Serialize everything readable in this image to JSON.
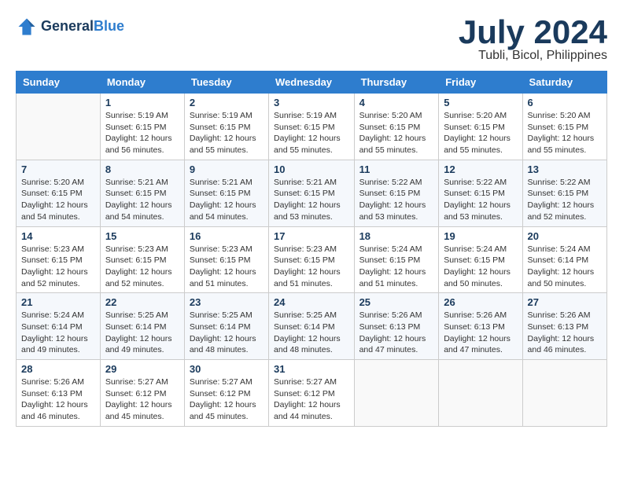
{
  "header": {
    "logo_line1": "General",
    "logo_line2": "Blue",
    "month": "July 2024",
    "location": "Tubli, Bicol, Philippines"
  },
  "weekdays": [
    "Sunday",
    "Monday",
    "Tuesday",
    "Wednesday",
    "Thursday",
    "Friday",
    "Saturday"
  ],
  "weeks": [
    [
      {
        "day": "",
        "info": ""
      },
      {
        "day": "1",
        "info": "Sunrise: 5:19 AM\nSunset: 6:15 PM\nDaylight: 12 hours\nand 56 minutes."
      },
      {
        "day": "2",
        "info": "Sunrise: 5:19 AM\nSunset: 6:15 PM\nDaylight: 12 hours\nand 55 minutes."
      },
      {
        "day": "3",
        "info": "Sunrise: 5:19 AM\nSunset: 6:15 PM\nDaylight: 12 hours\nand 55 minutes."
      },
      {
        "day": "4",
        "info": "Sunrise: 5:20 AM\nSunset: 6:15 PM\nDaylight: 12 hours\nand 55 minutes."
      },
      {
        "day": "5",
        "info": "Sunrise: 5:20 AM\nSunset: 6:15 PM\nDaylight: 12 hours\nand 55 minutes."
      },
      {
        "day": "6",
        "info": "Sunrise: 5:20 AM\nSunset: 6:15 PM\nDaylight: 12 hours\nand 55 minutes."
      }
    ],
    [
      {
        "day": "7",
        "info": "Sunrise: 5:20 AM\nSunset: 6:15 PM\nDaylight: 12 hours\nand 54 minutes."
      },
      {
        "day": "8",
        "info": "Sunrise: 5:21 AM\nSunset: 6:15 PM\nDaylight: 12 hours\nand 54 minutes."
      },
      {
        "day": "9",
        "info": "Sunrise: 5:21 AM\nSunset: 6:15 PM\nDaylight: 12 hours\nand 54 minutes."
      },
      {
        "day": "10",
        "info": "Sunrise: 5:21 AM\nSunset: 6:15 PM\nDaylight: 12 hours\nand 53 minutes."
      },
      {
        "day": "11",
        "info": "Sunrise: 5:22 AM\nSunset: 6:15 PM\nDaylight: 12 hours\nand 53 minutes."
      },
      {
        "day": "12",
        "info": "Sunrise: 5:22 AM\nSunset: 6:15 PM\nDaylight: 12 hours\nand 53 minutes."
      },
      {
        "day": "13",
        "info": "Sunrise: 5:22 AM\nSunset: 6:15 PM\nDaylight: 12 hours\nand 52 minutes."
      }
    ],
    [
      {
        "day": "14",
        "info": "Sunrise: 5:23 AM\nSunset: 6:15 PM\nDaylight: 12 hours\nand 52 minutes."
      },
      {
        "day": "15",
        "info": "Sunrise: 5:23 AM\nSunset: 6:15 PM\nDaylight: 12 hours\nand 52 minutes."
      },
      {
        "day": "16",
        "info": "Sunrise: 5:23 AM\nSunset: 6:15 PM\nDaylight: 12 hours\nand 51 minutes."
      },
      {
        "day": "17",
        "info": "Sunrise: 5:23 AM\nSunset: 6:15 PM\nDaylight: 12 hours\nand 51 minutes."
      },
      {
        "day": "18",
        "info": "Sunrise: 5:24 AM\nSunset: 6:15 PM\nDaylight: 12 hours\nand 51 minutes."
      },
      {
        "day": "19",
        "info": "Sunrise: 5:24 AM\nSunset: 6:15 PM\nDaylight: 12 hours\nand 50 minutes."
      },
      {
        "day": "20",
        "info": "Sunrise: 5:24 AM\nSunset: 6:14 PM\nDaylight: 12 hours\nand 50 minutes."
      }
    ],
    [
      {
        "day": "21",
        "info": "Sunrise: 5:24 AM\nSunset: 6:14 PM\nDaylight: 12 hours\nand 49 minutes."
      },
      {
        "day": "22",
        "info": "Sunrise: 5:25 AM\nSunset: 6:14 PM\nDaylight: 12 hours\nand 49 minutes."
      },
      {
        "day": "23",
        "info": "Sunrise: 5:25 AM\nSunset: 6:14 PM\nDaylight: 12 hours\nand 48 minutes."
      },
      {
        "day": "24",
        "info": "Sunrise: 5:25 AM\nSunset: 6:14 PM\nDaylight: 12 hours\nand 48 minutes."
      },
      {
        "day": "25",
        "info": "Sunrise: 5:26 AM\nSunset: 6:13 PM\nDaylight: 12 hours\nand 47 minutes."
      },
      {
        "day": "26",
        "info": "Sunrise: 5:26 AM\nSunset: 6:13 PM\nDaylight: 12 hours\nand 47 minutes."
      },
      {
        "day": "27",
        "info": "Sunrise: 5:26 AM\nSunset: 6:13 PM\nDaylight: 12 hours\nand 46 minutes."
      }
    ],
    [
      {
        "day": "28",
        "info": "Sunrise: 5:26 AM\nSunset: 6:13 PM\nDaylight: 12 hours\nand 46 minutes."
      },
      {
        "day": "29",
        "info": "Sunrise: 5:27 AM\nSunset: 6:12 PM\nDaylight: 12 hours\nand 45 minutes."
      },
      {
        "day": "30",
        "info": "Sunrise: 5:27 AM\nSunset: 6:12 PM\nDaylight: 12 hours\nand 45 minutes."
      },
      {
        "day": "31",
        "info": "Sunrise: 5:27 AM\nSunset: 6:12 PM\nDaylight: 12 hours\nand 44 minutes."
      },
      {
        "day": "",
        "info": ""
      },
      {
        "day": "",
        "info": ""
      },
      {
        "day": "",
        "info": ""
      }
    ]
  ]
}
